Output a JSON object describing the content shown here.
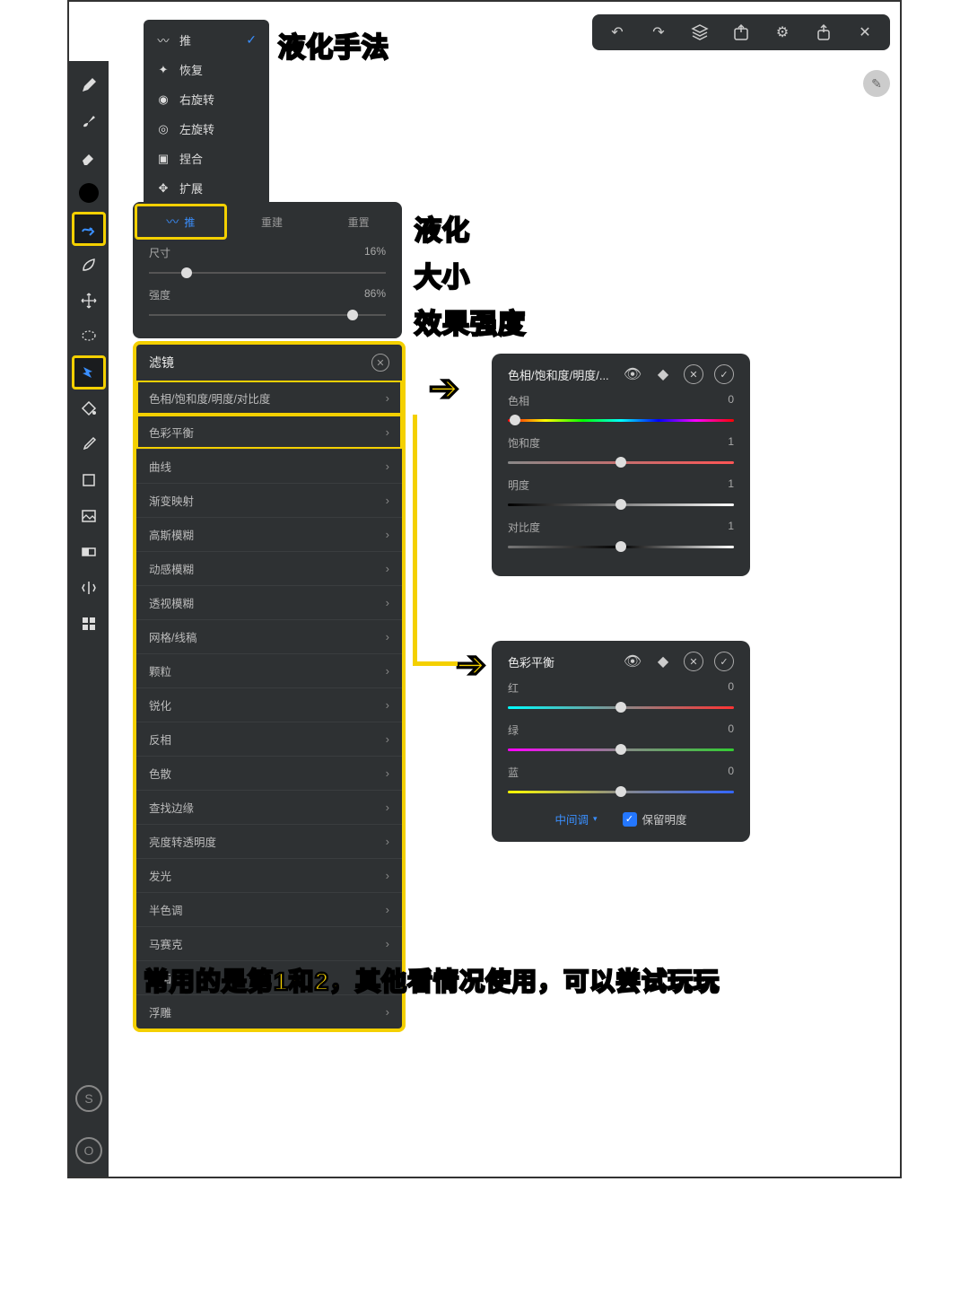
{
  "topbar": {
    "undo": "↶",
    "redo": "↷",
    "layers": "◆",
    "export": "⇪",
    "settings": "⚙",
    "share": "⇧",
    "close": "✕"
  },
  "lefttools": {
    "pencil": "pencil",
    "brush": "brush",
    "eraser": "eraser",
    "color": "color",
    "liquify": "liquify",
    "leaf": "leaf",
    "move": "move",
    "lasso": "lasso",
    "fx": "fx",
    "fill": "fill",
    "eyedrop": "eyedrop",
    "shape": "shape",
    "image": "image",
    "gradient": "gradient",
    "mirror": "mirror",
    "grid": "grid",
    "s_letter": "S",
    "o_letter": "O"
  },
  "liquify_menu": {
    "items": [
      {
        "label": "推",
        "selected": true
      },
      {
        "label": "恢复",
        "selected": false
      },
      {
        "label": "右旋转",
        "selected": false
      },
      {
        "label": "左旋转",
        "selected": false
      },
      {
        "label": "捏合",
        "selected": false
      },
      {
        "label": "扩展",
        "selected": false
      }
    ]
  },
  "liquify_panel": {
    "tab_push": "推",
    "tab_rebuild": "重建",
    "tab_reset": "重置",
    "size_label": "尺寸",
    "size_value": "16%",
    "size_pct": 16,
    "strength_label": "强度",
    "strength_value": "86%",
    "strength_pct": 86
  },
  "filters": {
    "title": "滤镜",
    "items": [
      {
        "label": "色相/饱和度/明度/对比度",
        "hl": true
      },
      {
        "label": "色彩平衡",
        "hl": true
      },
      {
        "label": "曲线"
      },
      {
        "label": "渐变映射"
      },
      {
        "label": "高斯模糊"
      },
      {
        "label": "动感模糊"
      },
      {
        "label": "透视模糊"
      },
      {
        "label": "网格/线稿"
      },
      {
        "label": "颗粒"
      },
      {
        "label": "锐化"
      },
      {
        "label": "反相"
      },
      {
        "label": "色散"
      },
      {
        "label": "查找边缘"
      },
      {
        "label": "亮度转透明度"
      },
      {
        "label": "发光"
      },
      {
        "label": "半色调"
      },
      {
        "label": "马赛克"
      },
      {
        "label": "油画"
      },
      {
        "label": "浮雕"
      }
    ]
  },
  "hsb_panel": {
    "title": "色相/饱和度/明度/...",
    "rows": [
      {
        "label": "色相",
        "value": "0",
        "pct": 3,
        "track": "hue-track"
      },
      {
        "label": "饱和度",
        "value": "1",
        "pct": 50,
        "track": "sat-track"
      },
      {
        "label": "明度",
        "value": "1",
        "pct": 50,
        "track": "bri-track"
      },
      {
        "label": "对比度",
        "value": "1",
        "pct": 50,
        "track": "con-track"
      }
    ]
  },
  "cb_panel": {
    "title": "色彩平衡",
    "rows": [
      {
        "label": "红",
        "value": "0",
        "pct": 50,
        "track": "red-track"
      },
      {
        "label": "绿",
        "value": "0",
        "pct": 50,
        "track": "grn-track"
      },
      {
        "label": "蓝",
        "value": "0",
        "pct": 50,
        "track": "blu-track"
      }
    ],
    "midtone": "中间调",
    "preserve": "保留明度"
  },
  "annotations": {
    "a1": "液化手法",
    "a2": "液化",
    "a3": "大小",
    "a4": "效果强度",
    "caption": "常用的是第1和2，其他看情况使用，可以尝试玩玩"
  }
}
